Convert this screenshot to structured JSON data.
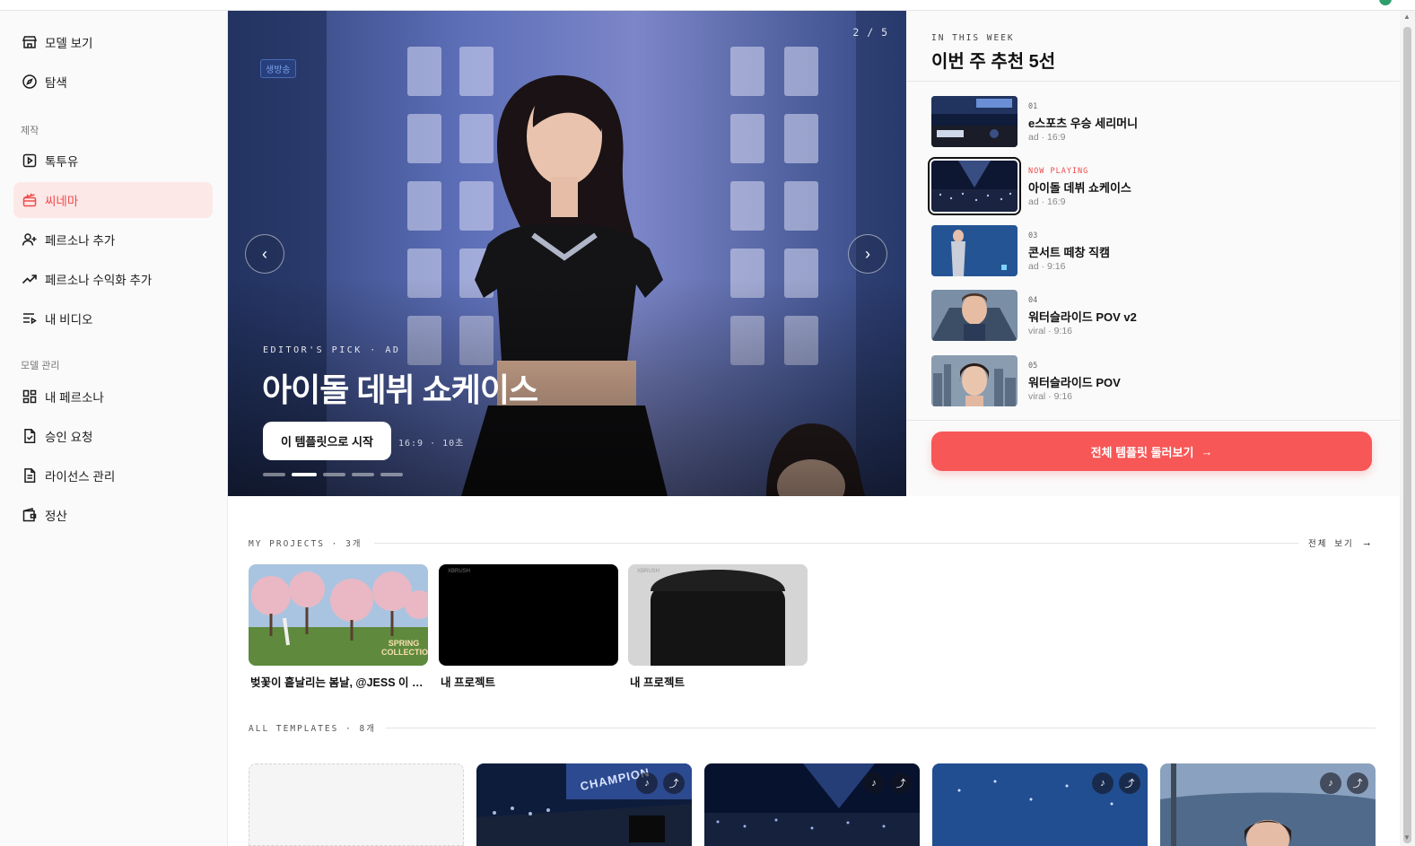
{
  "sidebar": {
    "items": [
      {
        "label": "모델 보기"
      },
      {
        "label": "탐색"
      },
      {
        "label": "톡투유"
      },
      {
        "label": "씨네마"
      },
      {
        "label": "페르소나 추가"
      },
      {
        "label": "페르소나 수익화 추가"
      },
      {
        "label": "내 비디오"
      },
      {
        "label": "내 페르소나"
      },
      {
        "label": "승인 요청"
      },
      {
        "label": "라이선스 관리"
      },
      {
        "label": "정산"
      }
    ],
    "sections": {
      "create": "제작",
      "manage": "모델 관리"
    },
    "active_color": "#ef4b4b"
  },
  "hero": {
    "counter": "2 / 5",
    "live_tag": "생방송",
    "kicker": "EDITOR'S PICK · AD",
    "title": "아이돌 데뷔 쇼케이스",
    "cta": "이 템플릿으로 시작",
    "meta": "16:9 · 10초",
    "slide_count": 5,
    "active_slide": 2
  },
  "week": {
    "eyebrow": "IN THIS WEEK",
    "heading": "이번 주 추천 5선",
    "items": [
      {
        "num": "01",
        "name": "e스포츠 우승 세리머니",
        "sub": "ad · 16:9"
      },
      {
        "num": "NOW PLAYING",
        "name": "아이돌 데뷔 쇼케이스",
        "sub": "ad · 16:9"
      },
      {
        "num": "03",
        "name": "콘서트 떼창 직캠",
        "sub": "ad · 9:16"
      },
      {
        "num": "04",
        "name": "워터슬라이드 POV v2",
        "sub": "viral · 9:16"
      },
      {
        "num": "05",
        "name": "워터슬라이드 POV",
        "sub": "viral · 9:16"
      }
    ],
    "browse_all": "전체 템플릿 둘러보기",
    "accent": "#f75757"
  },
  "projects": {
    "heading": "MY PROJECTS · 3개",
    "see_all": "전체 보기",
    "items": [
      {
        "name": "벚꽃이 흩날리는 봄날, @JESS 이 한...",
        "overlay": "SPRING COLLECTION"
      },
      {
        "name": "내 프로젝트",
        "overlay": "XBRUSH"
      },
      {
        "name": "내 프로젝트",
        "overlay": "XBRUSH"
      }
    ]
  },
  "templates": {
    "heading": "ALL TEMPLATES · 8개",
    "overlay_text": "CHAMPION"
  }
}
